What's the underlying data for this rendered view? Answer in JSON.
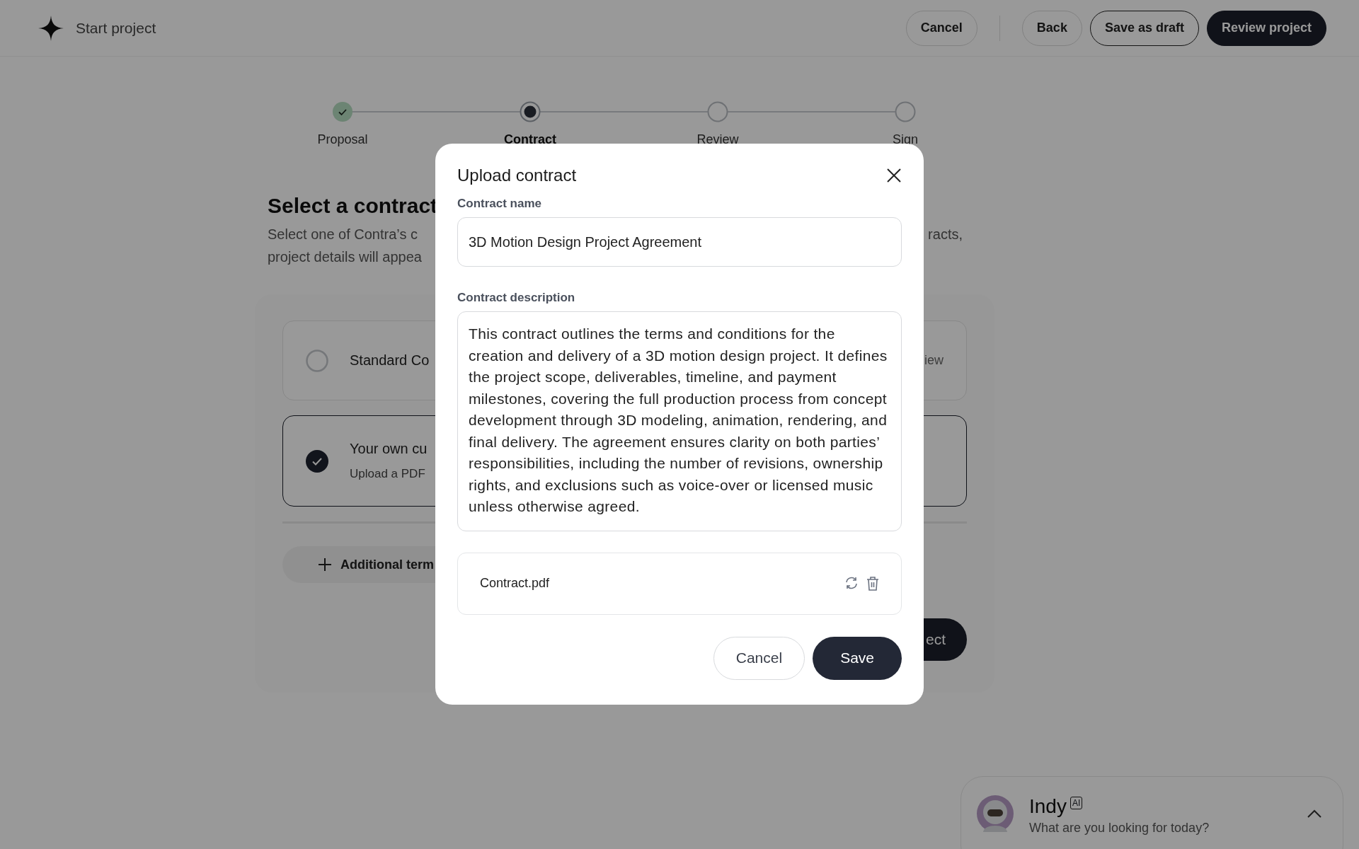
{
  "header": {
    "title": "Start project",
    "buttons": [
      {
        "label": "Cancel",
        "kind": "ghost"
      },
      {
        "label": "Back",
        "kind": "ghost"
      },
      {
        "label": "Save as draft",
        "kind": "outline"
      },
      {
        "label": "Review project",
        "kind": "primary"
      }
    ]
  },
  "stepper": [
    {
      "label": "Proposal",
      "completed": true,
      "selected": false
    },
    {
      "label": "Contract",
      "completed": false,
      "selected": true
    },
    {
      "label": "Review",
      "completed": false,
      "selected": false
    },
    {
      "label": "Sign",
      "completed": false,
      "selected": false
    }
  ],
  "section": {
    "title": "Select a contract",
    "description_lines": [
      {
        "start": "Select one of Contra’s c",
        "end": "racts,"
      },
      {
        "start": "project details will appea"
      }
    ]
  },
  "options": [
    {
      "title": "Standard Co",
      "end": "iew",
      "selected": false
    },
    {
      "title": "Your own cu",
      "subtitle": "Upload a PDF",
      "selected": true
    }
  ],
  "additional_terms": {
    "label": "Additional term"
  },
  "continue_button": {
    "label": "ect"
  },
  "modal": {
    "title": "Upload contract",
    "name_label": "Contract name",
    "name_value": "3D Motion Design Project Agreement",
    "description_label": "Contract description",
    "description_value": "This contract outlines the terms and conditions for the creation and delivery of a 3D motion design project. It defines the project scope, deliverables, timeline, and payment milestones, covering the full production process from concept development through 3D modeling, animation, rendering, and final delivery. The agreement ensures clarity on both parties’ responsibilities, including the number of revisions, ownership rights, and exclusions such as voice-over or licensed music unless otherwise agreed.",
    "file_name": "Contract.pdf",
    "buttons": [
      {
        "label": "Cancel",
        "kind": "outline"
      },
      {
        "label": "Save",
        "kind": "primary"
      }
    ]
  },
  "assistant": {
    "name": "Indy",
    "badge": "AI",
    "prompt": "What are you looking for today?"
  }
}
